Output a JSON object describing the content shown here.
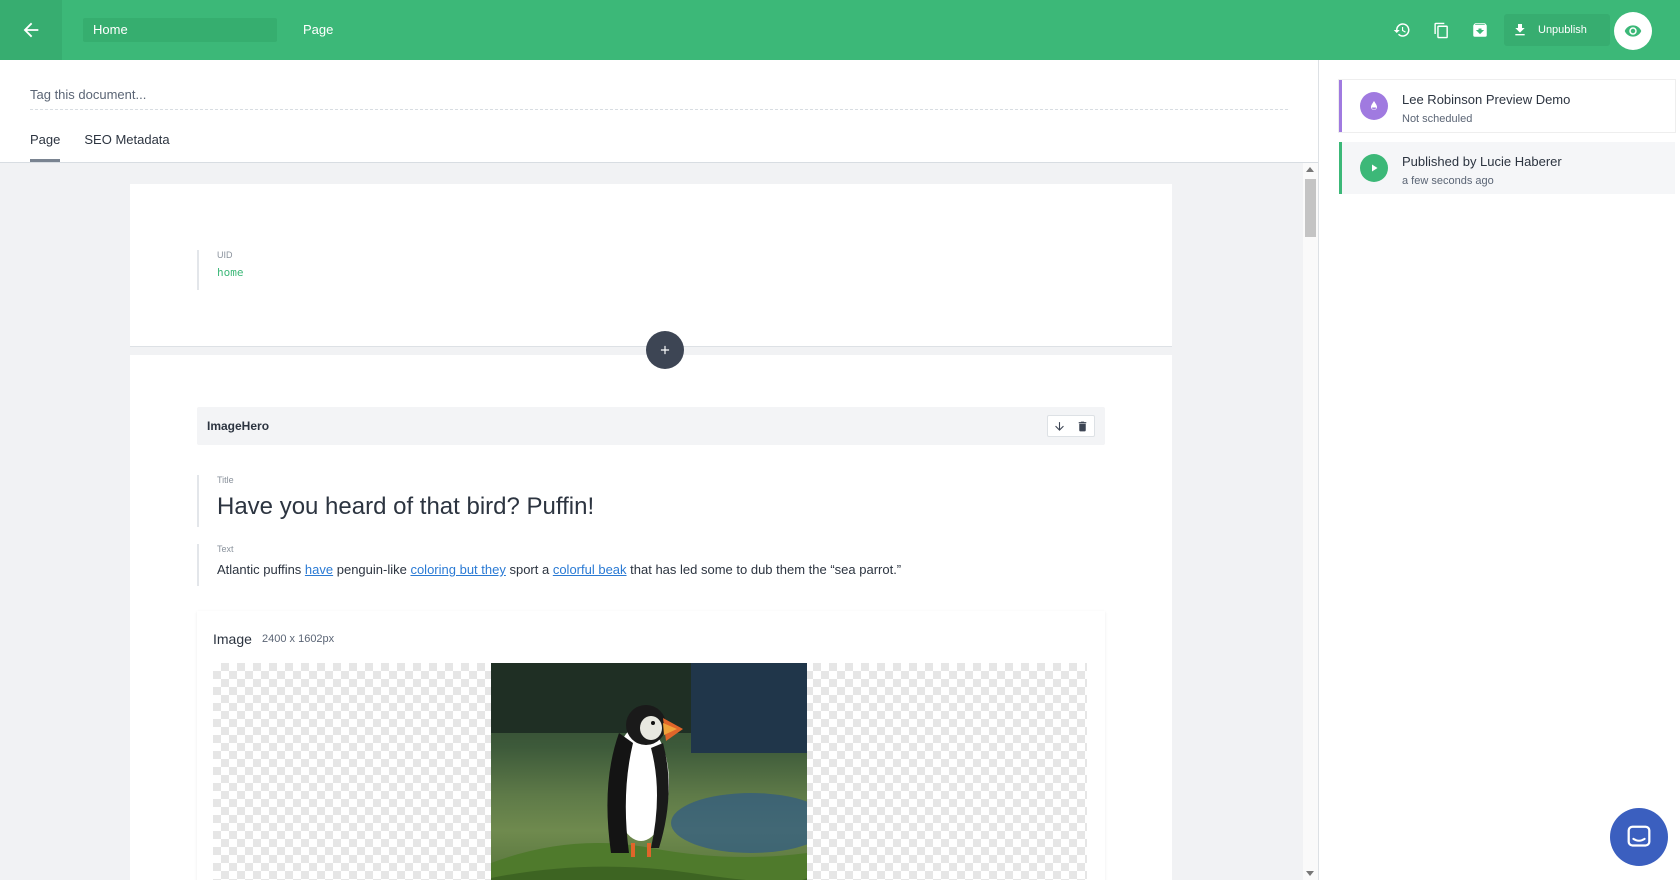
{
  "topbar": {
    "document_name": "Home",
    "document_type": "Page",
    "unpublish_label": "Unpublish",
    "accent": "#3cb878"
  },
  "editor": {
    "tag_placeholder": "Tag this document...",
    "tabs": [
      {
        "label": "Page",
        "active": true
      },
      {
        "label": "SEO Metadata",
        "active": false
      }
    ],
    "uid": {
      "label": "UID",
      "value": "home"
    },
    "slice": {
      "name": "ImageHero",
      "title_label": "Title",
      "title_value": "Have you heard of that bird? Puffin!",
      "text_label": "Text",
      "text_parts": {
        "p1": "Atlantic puffins ",
        "link1": "have",
        "p2": " penguin-like ",
        "link2": "coloring but they",
        "p3": " sport a ",
        "link3": "colorful beak",
        "p4": " that has led some to dub them the “sea parrot.”"
      },
      "image_label": "Image",
      "image_dims": "2400 x 1602px"
    }
  },
  "sidebar": {
    "releases": [
      {
        "title": "Lee Robinson Preview Demo",
        "subtitle": "Not scheduled",
        "color": "#a07ae0"
      },
      {
        "title": "Published by Lucie Haberer",
        "subtitle": "a few seconds ago",
        "color": "#3cb878"
      }
    ]
  }
}
